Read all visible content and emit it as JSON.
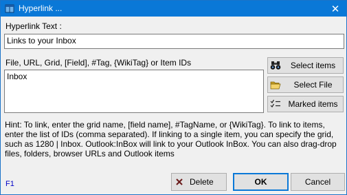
{
  "window": {
    "title": "Hyperlink ...",
    "close_glyph": "✕"
  },
  "hyperlink_text": {
    "label": "Hyperlink Text :",
    "value": "Links to your Inbox"
  },
  "target": {
    "label": "File, URL, Grid, [Field], #Tag, {WikiTag} or Item IDs",
    "value": "Inbox"
  },
  "side_buttons": {
    "select_items": "Select items",
    "select_file": "Select File",
    "marked_items": "Marked items"
  },
  "hint": "Hint: To link, enter the grid name, [field name], #TagName, or {WikiTag}. To link to items, enter the list of IDs (comma separated). If linking to a single item, you can specify the grid, such as 1280 | Inbox. Outlook:InBox will link to your Outlook InBox. You can also drag-drop files, folders, browser URLs and Outlook items",
  "help_key": "F1",
  "footer_buttons": {
    "delete": "Delete",
    "ok": "OK",
    "cancel": "Cancel"
  },
  "icons": {
    "title": "app-window-icon",
    "select_items": "binoculars-icon",
    "select_file": "folder-open-icon",
    "marked_items": "checklist-icon",
    "delete": "red-x-icon"
  },
  "colors": {
    "titlebar": "#0a78d7",
    "window_bg": "#f0f0f0",
    "help_link": "#0000c8"
  }
}
